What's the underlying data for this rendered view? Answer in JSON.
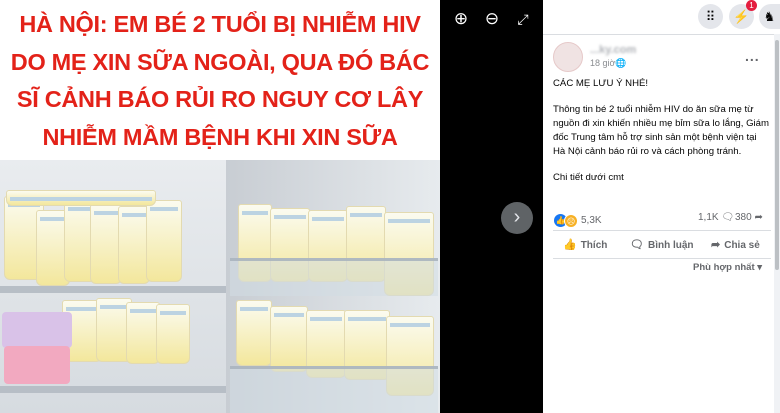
{
  "viewer": {
    "headline": "HÀ NỘI: EM BÉ 2 TUỔI BỊ NHIỄM HIV DO MẸ XIN SỮA NGOÀI, QUA ĐÓ BÁC SĨ CẢNH BÁO RỦI RO NGUY CƠ LÂY NHIỄM MẦM BỆNH KHI XIN SỮA KHÔNG RÕ NGUỒN GỐC",
    "zoom_in_icon": "zoom-in-icon",
    "zoom_out_icon": "zoom-out-icon",
    "fullscreen_icon": "fullscreen-icon",
    "next_icon": "chevron-right-icon"
  },
  "topbar": {
    "menu_icon": "grid-menu-icon",
    "messenger_icon": "messenger-icon",
    "notifications_icon": "bell-icon",
    "notification_count": "1"
  },
  "post": {
    "page_name": "...ky.com",
    "time": "18 giờ",
    "more_label": "...",
    "lines": [
      "CÁC MẸ LƯU Ý NHÉ!",
      "Thông tin bé 2 tuổi nhiễm HIV do ăn sữa mẹ từ nguồn đi xin khiến nhiều mẹ bỉm sữa lo lắng, Giám đốc Trung tâm hỗ trợ sinh sản một bệnh viện tại Hà Nội cảnh báo rủi ro và cách phòng tránh.",
      "Chi tiết dưới cmt"
    ],
    "reaction_count": "5,3K",
    "comment_count": "1,1K",
    "share_count": "380",
    "like_label": "Thích",
    "comment_label": "Bình luận",
    "share_label": "Chia sẻ",
    "sort_label": "Phù hợp nhất"
  },
  "colors": {
    "headline_red": "#e32219",
    "facebook_blue": "#1877f2",
    "notification_red": "#e41e3f"
  }
}
